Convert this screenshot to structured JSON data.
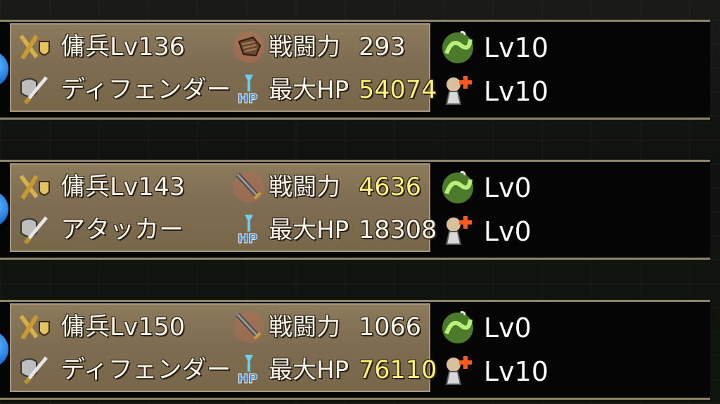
{
  "units": [
    {
      "class_label": "傭兵Lv136",
      "role_label": "ディフェンダー",
      "weapon_icon": "gauntlet-icon",
      "power_label": "戦闘力",
      "power_value": "293",
      "hp_label": "最大HP",
      "hp_value": "54074",
      "skill1_icon": "green-serpent-icon",
      "skill1_level": "Lv10",
      "skill2_icon": "heal-potion-icon",
      "skill2_level": "Lv10"
    },
    {
      "class_label": "傭兵Lv143",
      "role_label": "アタッカー",
      "weapon_icon": "sword-icon",
      "power_label": "戦闘力",
      "power_value": "4636",
      "hp_label": "最大HP",
      "hp_value": "18308",
      "skill1_icon": "green-serpent-icon",
      "skill1_level": "Lv0",
      "skill2_icon": "heal-potion-icon",
      "skill2_level": "Lv0"
    },
    {
      "class_label": "傭兵Lv150",
      "role_label": "ディフェンダー",
      "weapon_icon": "sword-icon",
      "power_label": "戦闘力",
      "power_value": "1066",
      "hp_label": "最大HP",
      "hp_value": "76110",
      "skill1_icon": "green-serpent-icon",
      "skill1_level": "Lv0",
      "skill2_icon": "heal-potion-icon",
      "skill2_level": "Lv10"
    }
  ],
  "colors": {
    "panel": "#7d6c51",
    "highlight_value": "#fbf37a",
    "normal_value": "#fbf6ea",
    "frame": "#8f8467"
  }
}
